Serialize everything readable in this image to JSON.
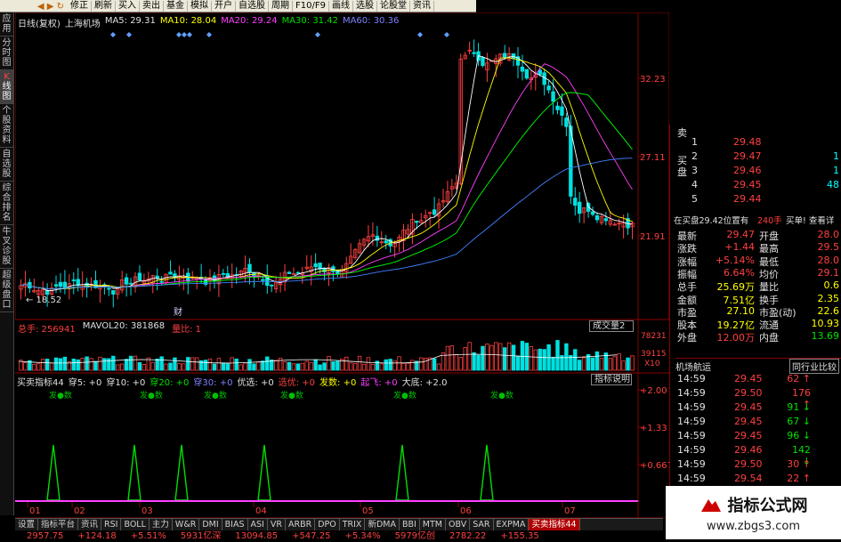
{
  "toolbar": {
    "items": [
      "修正",
      "刷新",
      "买入",
      "卖出",
      "基金",
      "模拟",
      "开户",
      "自选股",
      "周期",
      "F10/F9",
      "画线",
      "选股",
      "论股堂",
      "资讯"
    ]
  },
  "sidebar": {
    "tabs": [
      {
        "label": "应用",
        "active": false
      },
      {
        "label": "分时图",
        "active": false
      },
      {
        "label": "K线图",
        "active": true
      },
      {
        "label": "个股资料",
        "active": false
      },
      {
        "label": "自选股",
        "active": false
      },
      {
        "label": "综合排名",
        "active": false
      },
      {
        "label": "牛叉诊股",
        "active": false
      },
      {
        "label": "超级盘口",
        "active": false
      }
    ]
  },
  "chart_header": {
    "period": "日线(复权)",
    "stock": "上海机场",
    "ma5": "MA5: 29.31",
    "ma10": "MA10: 28.04",
    "ma20": "MA20: 29.24",
    "ma30": "MA30: 31.42",
    "ma60": "MA60: 30.36"
  },
  "price_axis": {
    "ticks": [
      "32.23",
      "27.11",
      "21.91"
    ],
    "low_label": "18.52",
    "cai_label": "财"
  },
  "volume_header": {
    "total": "总手: 256941",
    "mavol": "MAVOL20: 381868",
    "liangbi": "量比: 1",
    "selector": "成交量2",
    "axis_top": "78231",
    "axis_mid": "39115",
    "axis_unit": "X10"
  },
  "indicator_header": {
    "name": "买卖指标44",
    "items": [
      "穿5: +0",
      "穿10: +0",
      "穿20: +0",
      "穿30: +0",
      "优选: +0",
      "选优: +0",
      "发数: +0",
      "起飞: +0",
      "大底: +2.0"
    ],
    "explain_button": "指标说明",
    "signal_label": "发数",
    "axis_ticks": [
      "+2.00",
      "+1.33",
      "+0.667"
    ]
  },
  "x_axis": {
    "months": [
      "01",
      "02",
      "03",
      "04",
      "05",
      "06",
      "07"
    ]
  },
  "order_book": {
    "sell_label": "卖",
    "buy_label": "买盘",
    "levels": [
      {
        "n": "1",
        "price": "29.48"
      },
      {
        "n": "2",
        "price": "29.47"
      },
      {
        "n": "3",
        "price": "29.46"
      },
      {
        "n": "4",
        "price": "29.45"
      },
      {
        "n": "5",
        "price": "29.44"
      }
    ],
    "right_vals": [
      "1",
      "1",
      "48"
    ],
    "notice": "在买盘29.42位置有",
    "notice_qty": "240手",
    "notice_btn": "买单! 查看详"
  },
  "quote": {
    "rows": [
      {
        "l": "最新",
        "lv": "29.47",
        "r": "开盘",
        "rv": "28.0"
      },
      {
        "l": "涨跌",
        "lv": "+1.44",
        "r": "最高",
        "rv": "29.5"
      },
      {
        "l": "涨幅",
        "lv": "+5.14%",
        "r": "最低",
        "rv": "28.0"
      },
      {
        "l": "振幅",
        "lv": "6.64%",
        "r": "均价",
        "rv": "29.1"
      },
      {
        "l": "总手",
        "lv": "25.69万",
        "r": "量比",
        "rv": "0.6"
      },
      {
        "l": "金额",
        "lv": "7.51亿",
        "r": "换手",
        "rv": "2.35"
      },
      {
        "l": "市盈",
        "lv": "27.10",
        "r": "市盈(动)",
        "rv": "22.6"
      },
      {
        "l": "股本",
        "lv": "19.27亿",
        "r": "流通",
        "rv": "10.93"
      },
      {
        "l": "外盘",
        "lv": "12.00万",
        "r": "内盘",
        "rv": "13.69"
      }
    ]
  },
  "ticks_panel": {
    "left_tab": "机场航运",
    "right_tab": "同行业比较",
    "rows": [
      {
        "t": "14:59",
        "p": "29.45",
        "v": "62",
        "dir": "down"
      },
      {
        "t": "14:59",
        "p": "29.50",
        "v": "176",
        "dir": "down"
      },
      {
        "t": "14:59",
        "p": "29.45",
        "v": "91",
        "dir": "up"
      },
      {
        "t": "14:59",
        "p": "29.45",
        "v": "67",
        "dir": "up"
      },
      {
        "t": "14:59",
        "p": "29.45",
        "v": "96",
        "dir": "up"
      },
      {
        "t": "14:59",
        "p": "29.46",
        "v": "142",
        "dir": "up"
      },
      {
        "t": "14:59",
        "p": "29.50",
        "v": "30",
        "dir": "down"
      },
      {
        "t": "14:59",
        "p": "29.54",
        "v": "22",
        "dir": "down"
      }
    ]
  },
  "bottom_tabs": [
    "设置",
    "指标平台",
    "资讯",
    "RSI",
    "BOLL",
    "主力",
    "W&R",
    "DMI",
    "BIAS",
    "ASI",
    "VR",
    "ARBR",
    "DPO",
    "TRIX",
    "新DMA",
    "BBI",
    "MTM",
    "OBV",
    "SAR",
    "EXPMA",
    "买卖指标44"
  ],
  "bottom_tab_active": 20,
  "status_bar": [
    "2957.75",
    "+124.18",
    "+5.51%",
    "5931亿深",
    "13094.85",
    "+547.25",
    "+5.34%",
    "5979亿创",
    "2782.22",
    "+155.35"
  ],
  "watermark": {
    "title": "指标公式网",
    "url": "www.zbgs3.com"
  },
  "colors": {
    "up": "#ff4040",
    "down": "#00e0e0",
    "ma5": "#ffffff",
    "ma10": "#ffff00",
    "ma20": "#ff40ff",
    "ma30": "#00ff00",
    "ma60": "#4080ff",
    "grid": "#8b0000"
  }
}
